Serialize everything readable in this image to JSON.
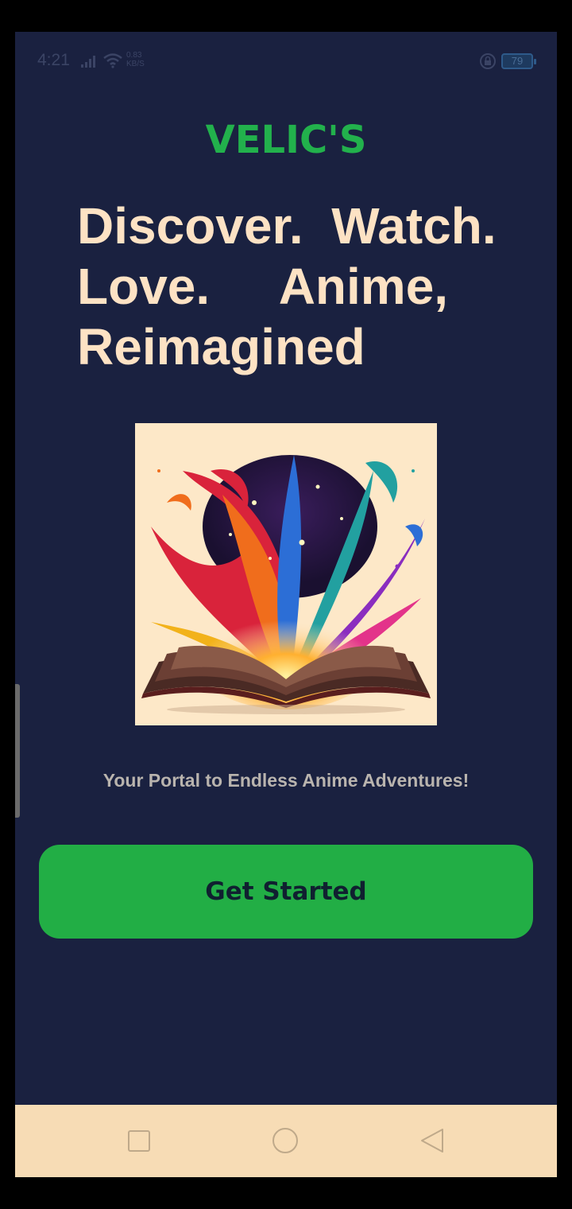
{
  "status_bar": {
    "time": "4:21",
    "net_speed_value": "0.83",
    "net_speed_unit": "KB/S",
    "battery_level": "79"
  },
  "brand": {
    "name": "VELIC'S",
    "color": "#22b14c"
  },
  "headline": {
    "line1": "Discover.  Watch.",
    "line2": "Love.     Anime,",
    "line3": "Reimagined"
  },
  "hero_image": {
    "description_icon": "open-book-splash-image"
  },
  "tagline": "Your Portal to Endless Anime Adventures!",
  "cta": {
    "label": "Get Started",
    "color": "#22ae45"
  },
  "nav": {
    "recent_icon": "square-icon",
    "home_icon": "circle-icon",
    "back_icon": "triangle-back-icon"
  },
  "colors": {
    "background": "#1a2140",
    "headline": "#fde2c4",
    "tagline": "#b9b4ae",
    "nav_bar": "#f7dcb5"
  }
}
